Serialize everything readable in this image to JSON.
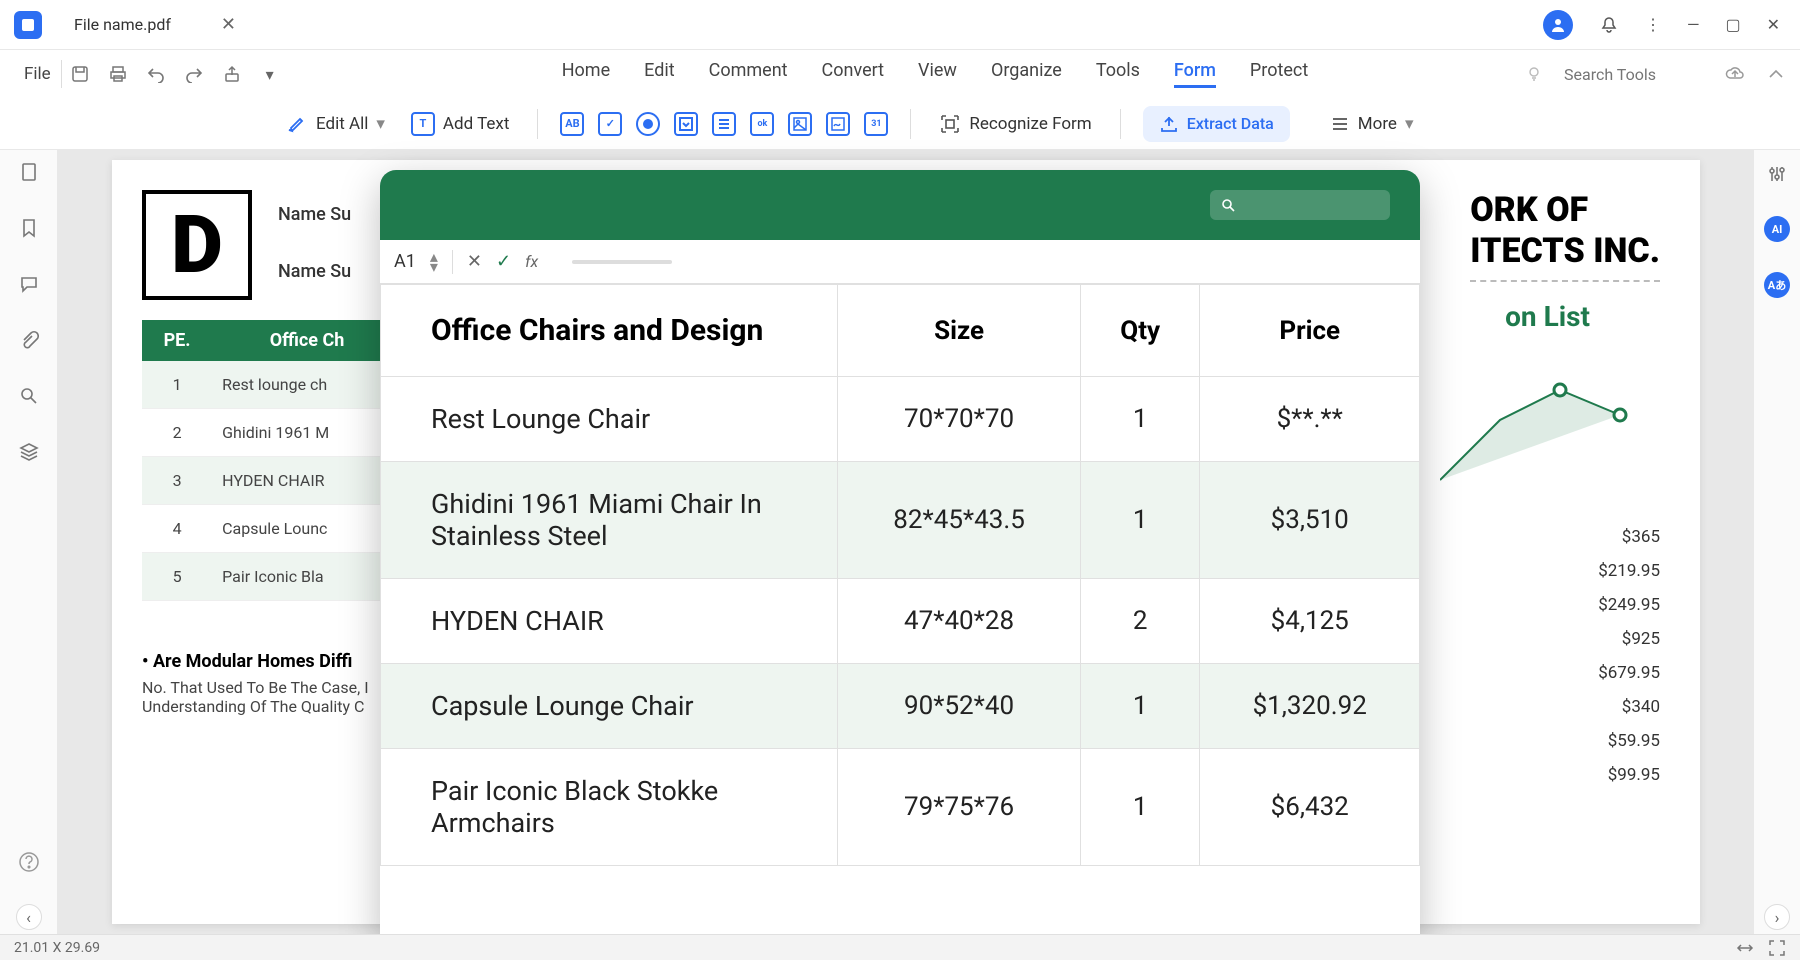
{
  "titlebar": {
    "filename": "File name.pdf"
  },
  "menu": {
    "file": "File",
    "tabs": [
      "Home",
      "Edit",
      "Comment",
      "Convert",
      "View",
      "Organize",
      "Tools",
      "Form",
      "Protect"
    ],
    "active_tab": "Form",
    "search_placeholder": "Search Tools"
  },
  "ribbon": {
    "edit_all": "Edit All",
    "add_text": "Add Text",
    "recognize_form": "Recognize Form",
    "extract_data": "Extract Data",
    "more": "More"
  },
  "doc": {
    "logo": "D",
    "name_label": "Name Su",
    "title_right_1": "ORK OF",
    "title_right_2": "ITECTS INC.",
    "on_list": "on List",
    "bg_table": {
      "headers": [
        "PE.",
        "Office Ch"
      ],
      "rows": [
        {
          "pe": "1",
          "name": "Rest lounge ch"
        },
        {
          "pe": "2",
          "name": "Ghidini 1961 M"
        },
        {
          "pe": "3",
          "name": "HYDEN CHAIR"
        },
        {
          "pe": "4",
          "name": "Capsule Lounc"
        },
        {
          "pe": "5",
          "name": "Pair Iconic Bla"
        }
      ]
    },
    "faq_q": "• Are Modular Homes Diffi",
    "faq_a": "No. That Used To Be The Case, I\nUnderstanding Of The Quality C",
    "prices": [
      "$365",
      "$219.95",
      "$249.95",
      "$925",
      "$679.95",
      "$340",
      "$59.95",
      "$99.95"
    ]
  },
  "sheet": {
    "cell_ref": "A1",
    "headers": {
      "col1": "Office Chairs and Design",
      "size": "Size",
      "qty": "Qty",
      "price": "Price"
    },
    "rows": [
      {
        "name": "Rest Lounge Chair",
        "size": "70*70*70",
        "qty": "1",
        "price": "$**.**"
      },
      {
        "name": "Ghidini 1961 Miami Chair In Stainless Steel",
        "size": "82*45*43.5",
        "qty": "1",
        "price": "$3,510"
      },
      {
        "name": "HYDEN CHAIR",
        "size": "47*40*28",
        "qty": "2",
        "price": "$4,125"
      },
      {
        "name": "Capsule Lounge Chair",
        "size": "90*52*40",
        "qty": "1",
        "price": "$1,320.92"
      },
      {
        "name": "Pair Iconic Black Stokke Armchairs",
        "size": "79*75*76",
        "qty": "1",
        "price": "$6,432"
      }
    ]
  },
  "status": {
    "dims": "21.01 X 29.69"
  }
}
